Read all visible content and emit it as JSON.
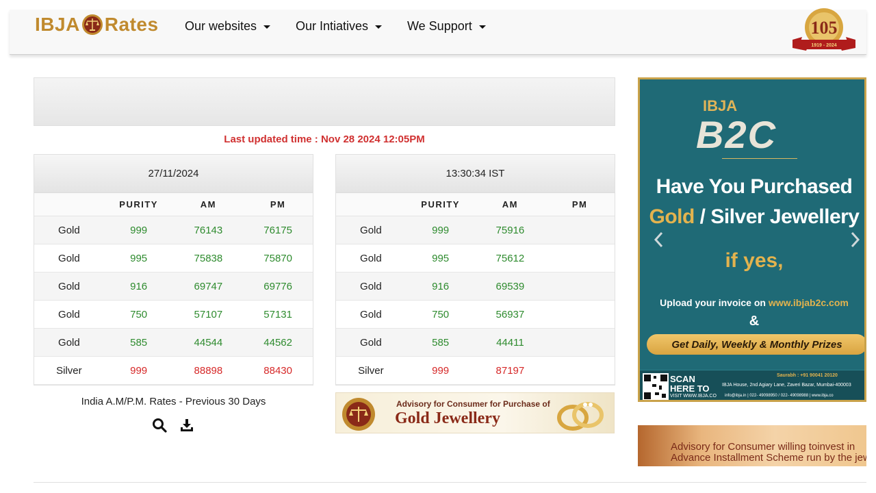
{
  "brand": {
    "left": "IBJA",
    "right": "Rates"
  },
  "nav": [
    {
      "label": "Our websites"
    },
    {
      "label": "Our Intiatives"
    },
    {
      "label": "We Support"
    }
  ],
  "anniversary": {
    "number": "105",
    "years": "1919 - 2024"
  },
  "last_updated": "Last updated time : Nov 28 2024 12:05PM",
  "columns": [
    "",
    "PURITY",
    "AM",
    "PM"
  ],
  "table_left": {
    "header": "27/11/2024",
    "rows": [
      {
        "metal": "Gold",
        "purity": "999",
        "am": "76143",
        "pm": "76175"
      },
      {
        "metal": "Gold",
        "purity": "995",
        "am": "75838",
        "pm": "75870"
      },
      {
        "metal": "Gold",
        "purity": "916",
        "am": "69747",
        "pm": "69776"
      },
      {
        "metal": "Gold",
        "purity": "750",
        "am": "57107",
        "pm": "57131"
      },
      {
        "metal": "Gold",
        "purity": "585",
        "am": "44544",
        "pm": "44562"
      },
      {
        "metal": "Silver",
        "purity": "999",
        "am": "88898",
        "pm": "88430"
      }
    ]
  },
  "table_right": {
    "header": "13:30:34 IST",
    "rows": [
      {
        "metal": "Gold",
        "purity": "999",
        "am": "75916",
        "pm": ""
      },
      {
        "metal": "Gold",
        "purity": "995",
        "am": "75612",
        "pm": ""
      },
      {
        "metal": "Gold",
        "purity": "916",
        "am": "69539",
        "pm": ""
      },
      {
        "metal": "Gold",
        "purity": "750",
        "am": "56937",
        "pm": ""
      },
      {
        "metal": "Gold",
        "purity": "585",
        "am": "44411",
        "pm": ""
      },
      {
        "metal": "Silver",
        "purity": "999",
        "am": "87197",
        "pm": ""
      }
    ]
  },
  "previous_label": "India A.M/P.M. Rates - Previous 30 Days",
  "advisory1": {
    "line1": "Advisory for Consumer for Purchase of",
    "line2": "Gold Jewellery"
  },
  "ad": {
    "ibja": "IBJA",
    "b2c": "B2C",
    "headline1": "Have You Purchased",
    "headline2_gold": "Gold",
    "headline2_rest": " / Silver Jewellery",
    "headline3": "if yes,",
    "upload_text": "Upload your invoice on ",
    "upload_url": "www.ibjab2c.com",
    "amp": "&",
    "prizes": "Get Daily, Weekly & Monthly Prizes",
    "scan": "SCAN",
    "here_to": "HERE TO",
    "visit": "VISIT WWW.IBJA.CO",
    "contact": "Saurabh : +91 90041 20120",
    "address": "IBJA House, 2nd Agiary Lane, Zaveri Bazar, Mumbai-400003",
    "mails": "info@ibja.in  |  022- 49098950 / 022- 49098988  |  www.ibja.co"
  },
  "advisory2": {
    "line1": "Advisory for Consumer willing toinvest in",
    "line2": "Advance Installment Scheme run by the jewel"
  },
  "colors": {
    "brand_gold": "#c08a2e",
    "green": "#2e8b2e",
    "red": "#d62828",
    "ad_teal": "#1f6a76"
  }
}
